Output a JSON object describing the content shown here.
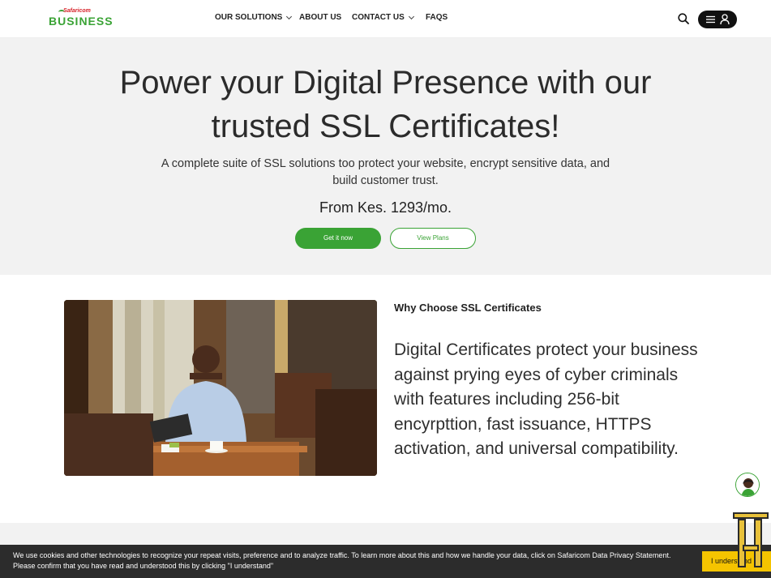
{
  "header": {
    "logo": {
      "small": "Safaricom",
      "big": "BUSINESS"
    },
    "nav": [
      {
        "label": "OUR SOLUTIONS"
      },
      {
        "label": "ABOUT US"
      },
      {
        "label": "CONTACT US"
      },
      {
        "label": "FAQS"
      }
    ],
    "icons": {
      "search": "search-icon",
      "menu": "hamburger-icon",
      "account": "user-icon"
    }
  },
  "hero": {
    "title": "Power your Digital Presence with our trusted SSL Certificates!",
    "subtitle": "A complete suite of SSL solutions too protect your website, encrypt sensitive data, and build customer trust.",
    "price": "From Kes. 1293/mo.",
    "primary_button": "Get it now",
    "secondary_button": "View Plans"
  },
  "why": {
    "label": "Why Choose SSL Certificates",
    "text": "Digital Certificates protect your business against prying eyes of cyber criminals with features including 256-bit encyrpttion, fast issuance, HTTPS activation, and universal compatibility."
  },
  "cookie": {
    "text": "We use cookies and other technologies to recognize your repeat visits, preference and to analyze traffic. To learn more about this and how we handle your data, click on Safaricom Data Privacy Statement. Please confirm that you have read and understood this by clicking \"I understand\"",
    "button": "I understand"
  },
  "colors": {
    "brand_green": "#3aa335",
    "brand_red": "#d61f26",
    "cookie_button": "#f5c400"
  }
}
